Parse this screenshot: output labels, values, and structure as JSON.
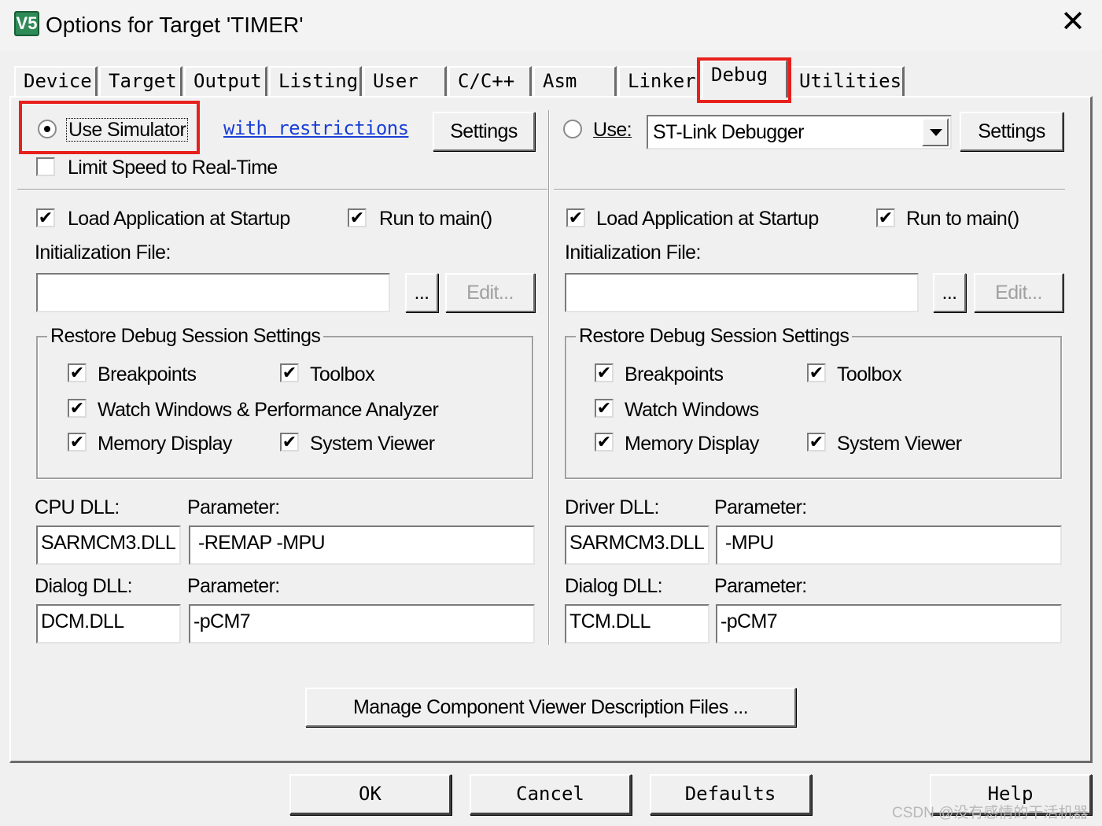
{
  "window": {
    "title": "Options for Target 'TIMER'",
    "icon": "uvision-logo-icon",
    "icon_text": "V5",
    "close_glyph": "✕"
  },
  "tabs": [
    "Device",
    "Target",
    "Output",
    "Listing",
    "User",
    "C/C++",
    "Asm",
    "Linker",
    "Debug",
    "Utilities"
  ],
  "active_tab": "Debug",
  "left": {
    "use_simulator_label": "Use Simulator",
    "use_simulator_selected": true,
    "restrictions_link": "with restrictions",
    "settings_label": "Settings",
    "limit_speed_label": "Limit Speed to Real-Time",
    "limit_speed_checked": false,
    "load_app_label": "Load Application at Startup",
    "run_to_main_label": "Run to main()",
    "init_file_label": "Initialization File:",
    "init_file_value": "",
    "browse_label": "...",
    "edit_label": "Edit...",
    "restore_group_title": "Restore Debug Session Settings",
    "breakpoints_label": "Breakpoints",
    "toolbox_label": "Toolbox",
    "watch_label": "Watch Windows & Performance Analyzer",
    "memory_label": "Memory Display",
    "sysviewer_label": "System Viewer",
    "cpu_dll_label": "CPU DLL:",
    "cpu_dll_value": "SARMCM3.DLL",
    "param_label": "Parameter:",
    "cpu_param_value": "-REMAP -MPU",
    "dialog_dll_label": "Dialog DLL:",
    "dialog_dll_value": "DCM.DLL",
    "dialog_param_value": "-pCM7"
  },
  "right": {
    "use_label": "Use:",
    "use_selected": false,
    "debugger_value": "ST-Link Debugger",
    "settings_label": "Settings",
    "load_app_label": "Load Application at Startup",
    "run_to_main_label": "Run to main()",
    "init_file_label": "Initialization File:",
    "init_file_value": "",
    "browse_label": "...",
    "edit_label": "Edit...",
    "restore_group_title": "Restore Debug Session Settings",
    "breakpoints_label": "Breakpoints",
    "toolbox_label": "Toolbox",
    "watch_label": "Watch Windows",
    "memory_label": "Memory Display",
    "sysviewer_label": "System Viewer",
    "driver_dll_label": "Driver DLL:",
    "driver_dll_value": "SARMCM3.DLL",
    "param_label": "Parameter:",
    "driver_param_value": "-MPU",
    "dialog_dll_label": "Dialog DLL:",
    "dialog_dll_value": "TCM.DLL",
    "dialog_param_value": "-pCM7"
  },
  "manage_button": "Manage Component Viewer Description Files ...",
  "buttons": {
    "ok": "OK",
    "cancel": "Cancel",
    "defaults": "Defaults",
    "help": "Help"
  },
  "check_glyph": "✔",
  "watermark": "CSDN @没有感情的干活机器",
  "colors": {
    "highlight_box": "#e8201c",
    "link": "#1a3fd6",
    "dialog_bg": "#f0f0f0"
  }
}
